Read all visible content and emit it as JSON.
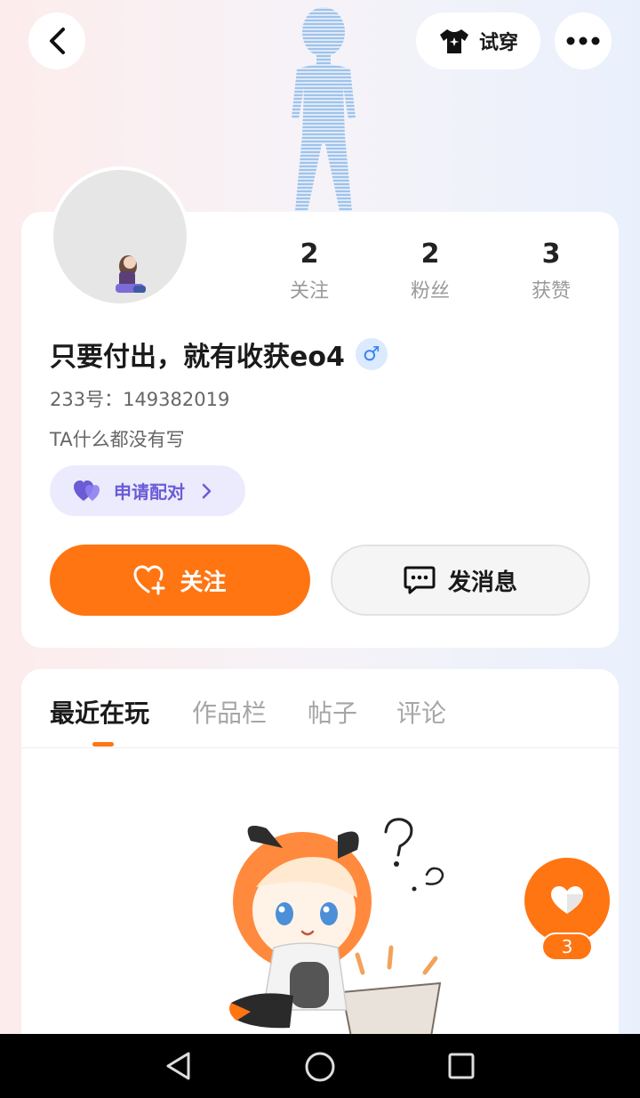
{
  "header": {
    "try_on_label": "试穿",
    "icons": [
      "back-icon",
      "tshirt-icon",
      "more-icon"
    ]
  },
  "profile": {
    "name": "只要付出，就有收获eo4",
    "gender_symbol": "♂",
    "uid": "233号：149382019",
    "bio": "TA什么都没有写",
    "pair_label": "申请配对",
    "stats": [
      {
        "value": "2",
        "label": "关注"
      },
      {
        "value": "2",
        "label": "粉丝"
      },
      {
        "value": "3",
        "label": "获赞"
      }
    ],
    "follow_label": "关注",
    "message_label": "发消息"
  },
  "tabs": [
    {
      "label": "最近在玩",
      "active": true
    },
    {
      "label": "作品栏",
      "active": false
    },
    {
      "label": "帖子",
      "active": false
    },
    {
      "label": "评论",
      "active": false
    }
  ],
  "like": {
    "count": "3"
  },
  "colors": {
    "accent": "#ff7512",
    "pair_bg": "#ecebfd",
    "pair_text": "#6b5bd6"
  },
  "system_nav": [
    "back-triangle-icon",
    "home-circle-icon",
    "recents-square-icon"
  ]
}
